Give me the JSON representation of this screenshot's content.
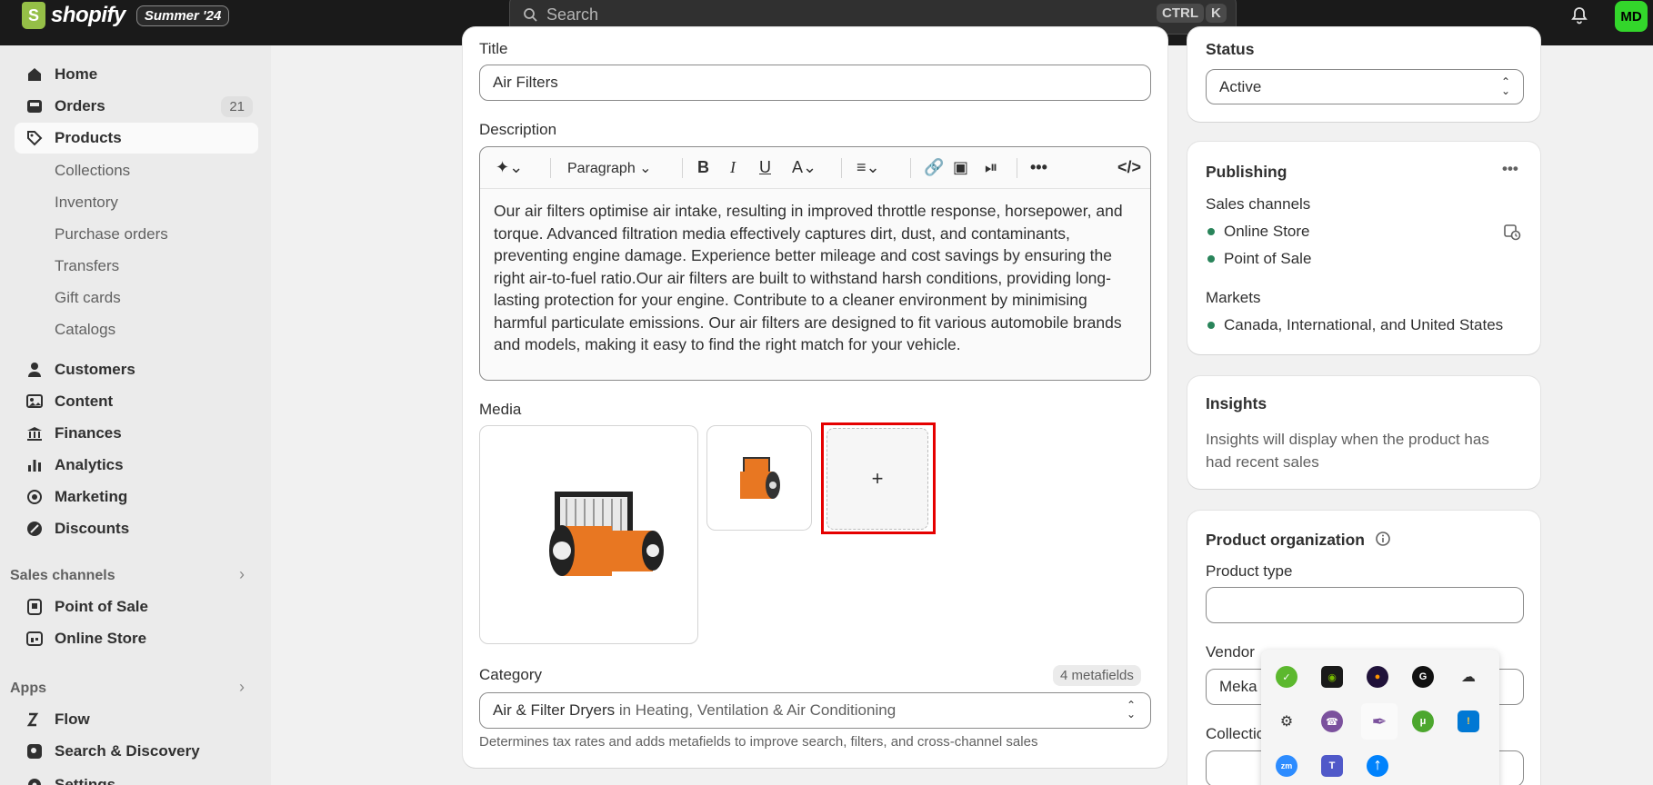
{
  "topbar": {
    "brand": "shopify",
    "edition_badge": "Summer '24",
    "search_placeholder": "Search",
    "shortcut_key1": "CTRL",
    "shortcut_key2": "K",
    "avatar_initials": "MD"
  },
  "sidebar": {
    "items": [
      {
        "label": "Home",
        "icon": "home-icon"
      },
      {
        "label": "Orders",
        "icon": "inbox-icon",
        "count": "21"
      },
      {
        "label": "Products",
        "icon": "tag-icon"
      },
      {
        "label": "Customers",
        "icon": "person-icon"
      },
      {
        "label": "Content",
        "icon": "image-icon"
      },
      {
        "label": "Finances",
        "icon": "bank-icon"
      },
      {
        "label": "Analytics",
        "icon": "bar-chart-icon"
      },
      {
        "label": "Marketing",
        "icon": "target-icon"
      },
      {
        "label": "Discounts",
        "icon": "discount-icon"
      }
    ],
    "product_subitems": [
      "Collections",
      "Inventory",
      "Purchase orders",
      "Transfers",
      "Gift cards",
      "Catalogs"
    ],
    "sales_channels_heading": "Sales channels",
    "sales_channels": [
      "Point of Sale",
      "Online Store"
    ],
    "apps_heading": "Apps",
    "apps": [
      "Flow",
      "Search & Discovery"
    ],
    "settings": "Settings"
  },
  "product": {
    "title_label": "Title",
    "title_value": "Air Filters",
    "description_label": "Description",
    "paragraph_select": "Paragraph",
    "description": "Our air filters optimise air intake, resulting in improved throttle response, horsepower, and torque. Advanced filtration media effectively captures dirt, dust, and contaminants, preventing engine damage. Experience better mileage and cost savings by ensuring the right air-to-fuel ratio.Our air filters are built to withstand harsh conditions, providing long-lasting protection for your engine. Contribute to a cleaner environment by minimising harmful particulate emissions. Our air filters are designed to fit various automobile brands and models, making it easy to find the right match for your vehicle.",
    "media_label": "Media",
    "add_media_symbol": "+",
    "category_label": "Category",
    "metafields_badge": "4 metafields",
    "category_name": "Air & Filter Dryers",
    "category_in": " in Heating, Ventilation & Air Conditioning",
    "category_help": "Determines tax rates and adds metafields to improve search, filters, and cross-channel sales"
  },
  "status": {
    "heading": "Status",
    "value": "Active"
  },
  "publishing": {
    "heading": "Publishing",
    "sales_channels_label": "Sales channels",
    "channels": [
      "Online Store",
      "Point of Sale"
    ],
    "markets_label": "Markets",
    "markets": "Canada, International, and United States"
  },
  "insights": {
    "heading": "Insights",
    "text": "Insights will display when the product has had recent sales"
  },
  "organization": {
    "heading": "Product organization",
    "product_type_label": "Product type",
    "product_type_value": "",
    "vendor_label": "Vendor",
    "vendor_value": "Meka",
    "collections_label": "Collectio"
  },
  "tray_icons": [
    "shield-check-icon",
    "nvidia-icon",
    "firefox-icon",
    "grammarly-icon",
    "cloud-off-icon",
    "camera-app-icon",
    "viber-icon",
    "feather-icon",
    "utorrent-icon",
    "security-warning-icon",
    "zoom-icon",
    "teams-icon",
    "bluetooth-icon"
  ],
  "colors": {
    "accent_red": "#e50000",
    "status_green": "#29845a",
    "avatar_green": "#33d62b"
  }
}
